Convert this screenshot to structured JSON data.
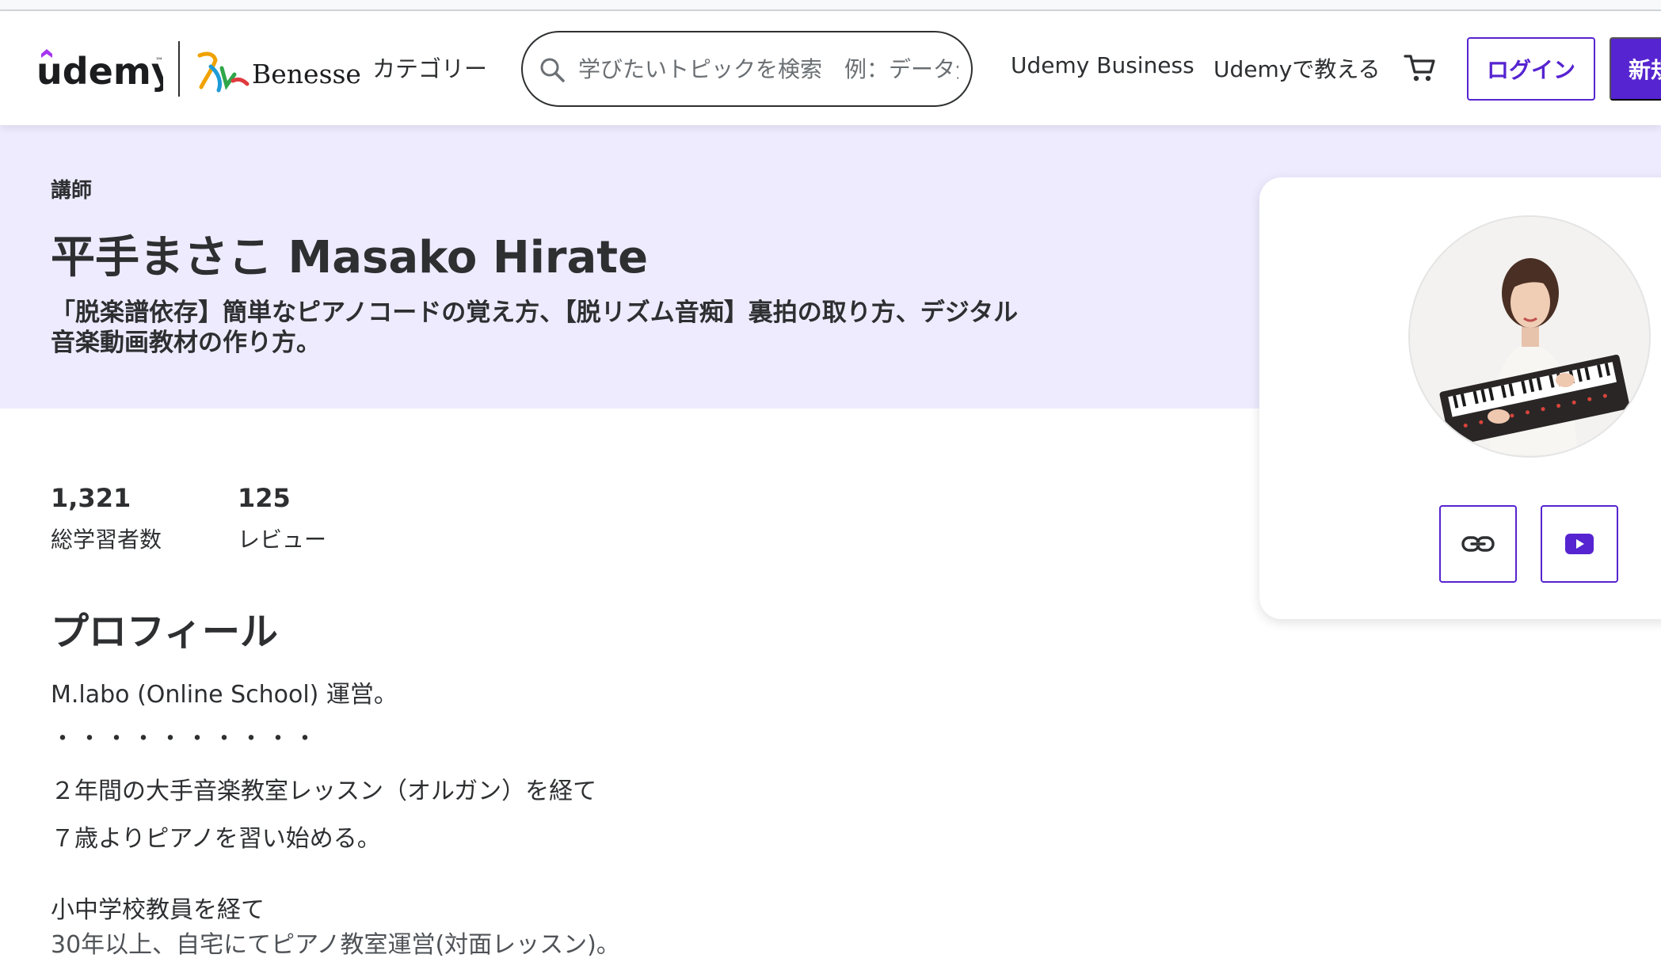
{
  "header": {
    "brand": "udemy",
    "brand_tm": "™",
    "partner": "Benesse",
    "categories": "カテゴリー",
    "search_placeholder": "学びたいトピックを検索　例：データ分析",
    "udemy_business": "Udemy Business",
    "teach": "Udemyで教える",
    "login": "ログイン",
    "signup": "新規登録"
  },
  "hero": {
    "eyebrow": "講師",
    "name": "平手まさこ Masako Hirate",
    "headline": "「脱楽譜依存】簡単なピアノコードの覚え方、【脱リズム音痴】裏拍の取り方、デジタル音楽動画教材の作り方。"
  },
  "stats": [
    {
      "value": "1,321",
      "label": "総学習者数"
    },
    {
      "value": "125",
      "label": "レビュー"
    }
  ],
  "profile": {
    "heading": "プロフィール",
    "lines": [
      "M.labo (Online School)  運営。",
      "・・・・・・・・・・",
      "２年間の大手音楽教室レッスン（オルガン）を経て",
      "７歳よりピアノを習い始める。",
      "小中学校教員を経て",
      "30年以上、自宅にてピアノ教室運営(対面レッスン)。"
    ]
  },
  "social": {
    "website": "link-icon",
    "youtube": "youtube-icon"
  },
  "colors": {
    "accent": "#5624d0",
    "hero_bg": "#eeebff",
    "text": "#2d2f31"
  }
}
